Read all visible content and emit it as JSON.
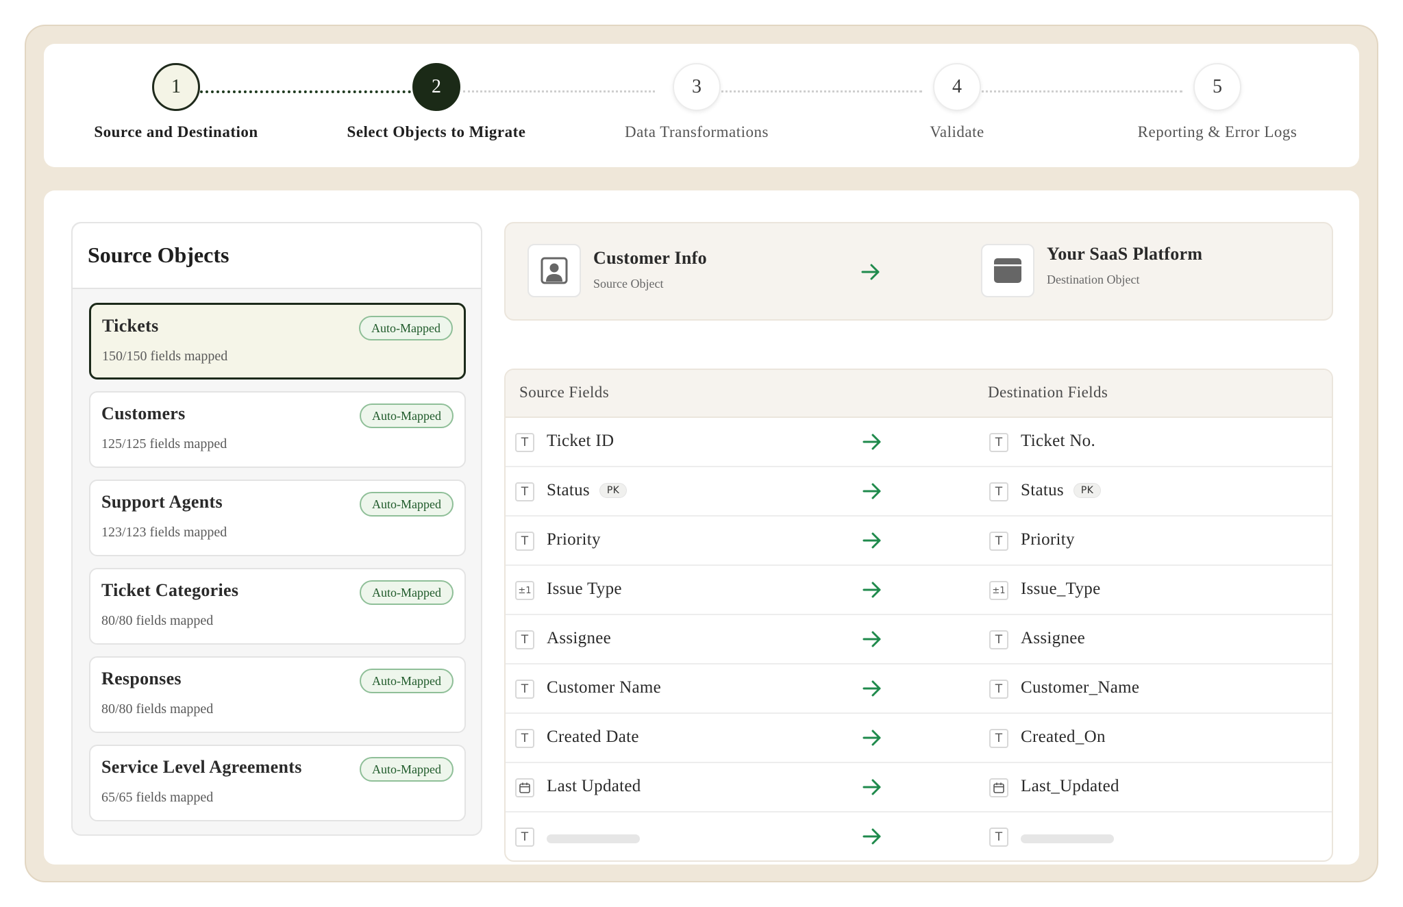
{
  "stepper": {
    "steps": [
      {
        "number": "1",
        "label": "Source and Destination",
        "state": "done"
      },
      {
        "number": "2",
        "label": "Select Objects to Migrate",
        "state": "active"
      },
      {
        "number": "3",
        "label": "Data Transformations",
        "state": "pending"
      },
      {
        "number": "4",
        "label": "Validate",
        "state": "pending"
      },
      {
        "number": "5",
        "label": "Reporting & Error Logs",
        "state": "pending"
      }
    ]
  },
  "source_objects": {
    "title": "Source Objects",
    "items": [
      {
        "name": "Tickets",
        "fields": "150/150 fields mapped",
        "badge": "Auto-Mapped",
        "selected": true
      },
      {
        "name": "Customers",
        "fields": "125/125 fields mapped",
        "badge": "Auto-Mapped",
        "selected": false
      },
      {
        "name": "Support Agents",
        "fields": "123/123 fields mapped",
        "badge": "Auto-Mapped",
        "selected": false
      },
      {
        "name": "Ticket Categories",
        "fields": "80/80 fields mapped",
        "badge": "Auto-Mapped",
        "selected": false
      },
      {
        "name": "Responses",
        "fields": "80/80 fields mapped",
        "badge": "Auto-Mapped",
        "selected": false
      },
      {
        "name": "Service Level Agreements",
        "fields": "65/65 fields mapped",
        "badge": "Auto-Mapped",
        "selected": false
      }
    ]
  },
  "mapping_header": {
    "source_title": "Customer Info",
    "source_sub": "Source Object",
    "source_icon": "user-card-icon",
    "dest_title": "Your SaaS Platform",
    "dest_sub": "Destination Object",
    "dest_icon": "browser-window-icon",
    "arrow_icon": "arrow-right-icon"
  },
  "fields_table": {
    "source_header": "Source Fields",
    "dest_header": "Destination Fields",
    "pk_label": "PK",
    "rows": [
      {
        "src_icon": "T",
        "src": "Ticket ID",
        "dst_icon": "T",
        "dst": "Ticket No.",
        "pk": false
      },
      {
        "src_icon": "T",
        "src": "Status",
        "dst_icon": "T",
        "dst": "Status",
        "pk": true
      },
      {
        "src_icon": "T",
        "src": "Priority",
        "dst_icon": "T",
        "dst": "Priority",
        "pk": false
      },
      {
        "src_icon": "±1",
        "src": "Issue Type",
        "dst_icon": "±1",
        "dst": "Issue_Type",
        "pk": false
      },
      {
        "src_icon": "T",
        "src": "Assignee",
        "dst_icon": "T",
        "dst": "Assignee",
        "pk": false
      },
      {
        "src_icon": "T",
        "src": "Customer Name",
        "dst_icon": "T",
        "dst": "Customer_Name",
        "pk": false
      },
      {
        "src_icon": "T",
        "src": "Created Date",
        "dst_icon": "T",
        "dst": "Created_On",
        "pk": false
      },
      {
        "src_icon": "calendar",
        "src": "Last Updated",
        "dst_icon": "calendar",
        "dst": "Last_Updated",
        "pk": false
      },
      {
        "src_icon": "T",
        "src": "",
        "dst_icon": "T",
        "dst": "",
        "pk": false,
        "loading": true
      }
    ]
  },
  "colors": {
    "frame": "#efe7d9",
    "accent_dark": "#1b2a17",
    "arrow_green": "#1f8a4c",
    "badge_border": "#8fbf98"
  }
}
